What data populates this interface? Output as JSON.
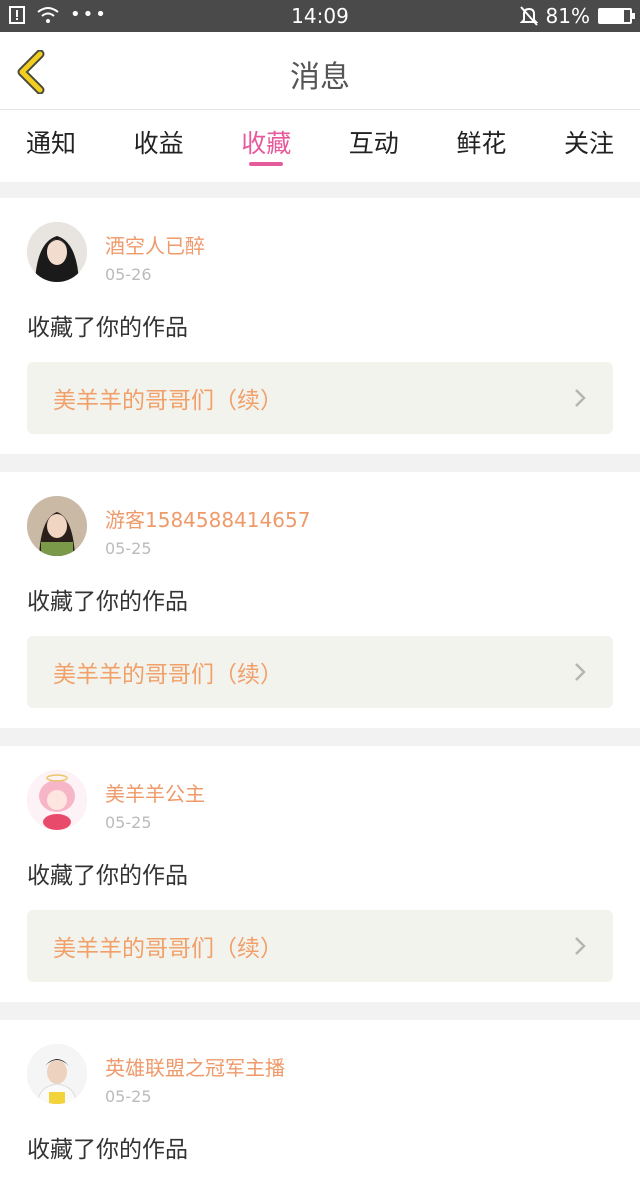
{
  "status": {
    "time": "14:09",
    "battery": "81%",
    "battery_level": 0.81
  },
  "header": {
    "title": "消息"
  },
  "tabs": [
    {
      "label": "通知",
      "active": false
    },
    {
      "label": "收益",
      "active": false
    },
    {
      "label": "收藏",
      "active": true
    },
    {
      "label": "互动",
      "active": false
    },
    {
      "label": "鲜花",
      "active": false
    },
    {
      "label": "关注",
      "active": false
    }
  ],
  "messages": [
    {
      "username": "酒空人已醉",
      "date": "05-26",
      "action": "收藏了你的作品",
      "work": "美羊羊的哥哥们（续）"
    },
    {
      "username": "游客1584588414657",
      "date": "05-25",
      "action": "收藏了你的作品",
      "work": "美羊羊的哥哥们（续）"
    },
    {
      "username": "美羊羊公主",
      "date": "05-25",
      "action": "收藏了你的作品",
      "work": "美羊羊的哥哥们（续）"
    },
    {
      "username": "英雄联盟之冠军主播",
      "date": "05-25",
      "action": "收藏了你的作品",
      "work": ""
    }
  ],
  "colors": {
    "accent": "#e65b9b",
    "username": "#ef9a6a",
    "work_title": "#f1a06a",
    "back_icon": "#f2cf1f"
  }
}
